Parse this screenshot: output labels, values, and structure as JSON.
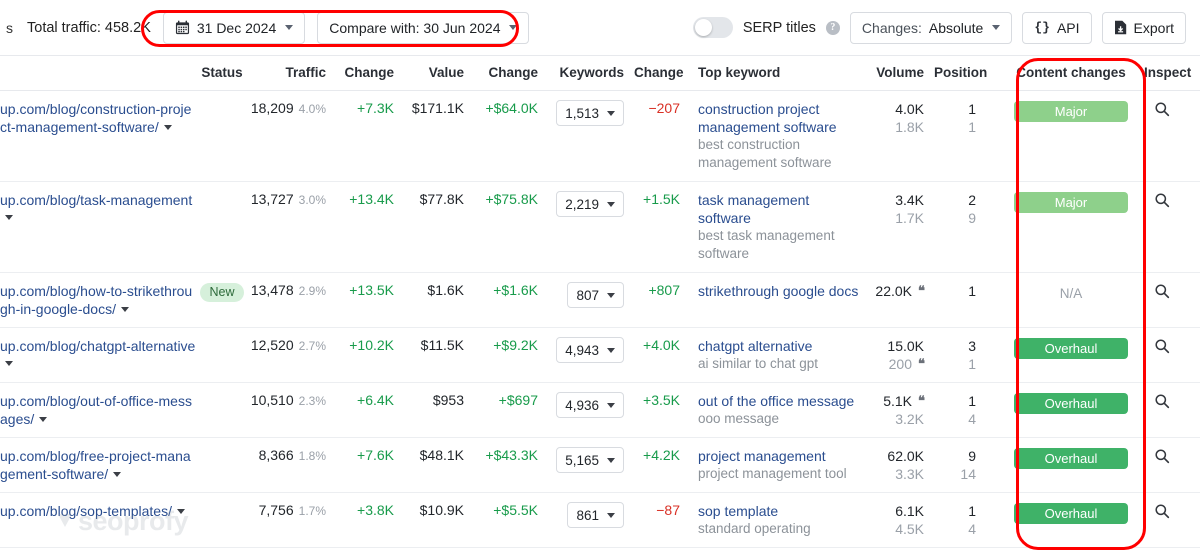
{
  "toolbar": {
    "tab_tail": "s",
    "total_traffic": "Total traffic: 458.2K",
    "date_button": "31 Dec 2024",
    "compare_button": "Compare with: 30 Jun 2024",
    "serp_titles_label": "SERP titles",
    "serp_titles_toggle": "off",
    "changes_label": "Changes:",
    "changes_value": "Absolute",
    "api_label": "API",
    "export_label": "Export",
    "calendar_icon": "calendar-icon",
    "help_icon": "help-icon",
    "api_icon": "code-braces-icon",
    "export_icon": "download-file-icon"
  },
  "watermark": "seoprofy",
  "colors": {
    "link": "#2a4d8f",
    "positive": "#189b4b",
    "negative": "#d93025",
    "chip_major": "#8ed08b",
    "chip_overhaul": "#3fb268",
    "badge_new_bg": "#d6f0db",
    "annotation": "#ff0000"
  },
  "table": {
    "columns": [
      {
        "key": "url",
        "label": ""
      },
      {
        "key": "status",
        "label": "Status"
      },
      {
        "key": "traffic",
        "label": "Traffic"
      },
      {
        "key": "traffic_change",
        "label": "Change"
      },
      {
        "key": "value",
        "label": "Value"
      },
      {
        "key": "value_change",
        "label": "Change"
      },
      {
        "key": "keywords",
        "label": "Keywords"
      },
      {
        "key": "keywords_change",
        "label": "Change"
      },
      {
        "key": "top_keyword",
        "label": "Top keyword"
      },
      {
        "key": "volume",
        "label": "Volume"
      },
      {
        "key": "position",
        "label": "Position"
      },
      {
        "key": "content_changes",
        "label": "Content changes"
      },
      {
        "key": "inspect",
        "label": "Inspect"
      }
    ],
    "rows": [
      {
        "url": "up.com/blog/construction-project-management-software/",
        "status": "",
        "traffic": "18,209",
        "traffic_pct": "4.0%",
        "traffic_change": "+7.3K",
        "traffic_change_dir": "pos",
        "value": "$171.1K",
        "value_change": "+$64.0K",
        "value_change_dir": "pos",
        "keywords": "1,513",
        "keywords_change": "−207",
        "keywords_change_dir": "neg",
        "keyword_main": "construction project management software",
        "keyword_sub": "best construction management software",
        "volume_main": "4.0K",
        "volume_sub": "1.8K",
        "volume_main_quote": false,
        "volume_sub_quote": false,
        "position_main": "1",
        "position_sub": "1",
        "content_changes": "Major",
        "content_changes_type": "major",
        "inspect_icon": "magnifier-icon"
      },
      {
        "url": "up.com/blog/task-management",
        "status": "",
        "traffic": "13,727",
        "traffic_pct": "3.0%",
        "traffic_change": "+13.4K",
        "traffic_change_dir": "pos",
        "value": "$77.8K",
        "value_change": "+$75.8K",
        "value_change_dir": "pos",
        "keywords": "2,219",
        "keywords_change": "+1.5K",
        "keywords_change_dir": "pos",
        "keyword_main": "task management software",
        "keyword_sub": "best task management software",
        "volume_main": "3.4K",
        "volume_sub": "1.7K",
        "volume_main_quote": false,
        "volume_sub_quote": false,
        "position_main": "2",
        "position_sub": "9",
        "content_changes": "Major",
        "content_changes_type": "major",
        "inspect_icon": "magnifier-icon"
      },
      {
        "url": "up.com/blog/how-to-strikethrough-in-google-docs/",
        "status": "New",
        "traffic": "13,478",
        "traffic_pct": "2.9%",
        "traffic_change": "+13.5K",
        "traffic_change_dir": "pos",
        "value": "$1.6K",
        "value_change": "+$1.6K",
        "value_change_dir": "pos",
        "keywords": "807",
        "keywords_change": "+807",
        "keywords_change_dir": "pos",
        "keyword_main": "strikethrough google docs",
        "keyword_sub": "",
        "volume_main": "22.0K",
        "volume_sub": "",
        "volume_main_quote": true,
        "volume_sub_quote": false,
        "position_main": "1",
        "position_sub": "",
        "content_changes": "N/A",
        "content_changes_type": "na",
        "inspect_icon": "magnifier-icon"
      },
      {
        "url": "up.com/blog/chatgpt-alternative",
        "status": "",
        "traffic": "12,520",
        "traffic_pct": "2.7%",
        "traffic_change": "+10.2K",
        "traffic_change_dir": "pos",
        "value": "$11.5K",
        "value_change": "+$9.2K",
        "value_change_dir": "pos",
        "keywords": "4,943",
        "keywords_change": "+4.0K",
        "keywords_change_dir": "pos",
        "keyword_main": "chatgpt alternative",
        "keyword_sub": "ai similar to chat gpt",
        "volume_main": "15.0K",
        "volume_sub": "200",
        "volume_main_quote": false,
        "volume_sub_quote": true,
        "position_main": "3",
        "position_sub": "1",
        "content_changes": "Overhaul",
        "content_changes_type": "overhaul",
        "inspect_icon": "magnifier-icon"
      },
      {
        "url": "up.com/blog/out-of-office-messages/",
        "status": "",
        "traffic": "10,510",
        "traffic_pct": "2.3%",
        "traffic_change": "+6.4K",
        "traffic_change_dir": "pos",
        "value": "$953",
        "value_change": "+$697",
        "value_change_dir": "pos",
        "keywords": "4,936",
        "keywords_change": "+3.5K",
        "keywords_change_dir": "pos",
        "keyword_main": "out of the office message",
        "keyword_sub": "ooo message",
        "volume_main": "5.1K",
        "volume_sub": "3.2K",
        "volume_main_quote": true,
        "volume_sub_quote": false,
        "position_main": "1",
        "position_sub": "4",
        "content_changes": "Overhaul",
        "content_changes_type": "overhaul",
        "inspect_icon": "magnifier-icon"
      },
      {
        "url": "up.com/blog/free-project-management-software/",
        "status": "",
        "traffic": "8,366",
        "traffic_pct": "1.8%",
        "traffic_change": "+7.6K",
        "traffic_change_dir": "pos",
        "value": "$48.1K",
        "value_change": "+$43.3K",
        "value_change_dir": "pos",
        "keywords": "5,165",
        "keywords_change": "+4.2K",
        "keywords_change_dir": "pos",
        "keyword_main": "project management",
        "keyword_sub": "project management tool",
        "volume_main": "62.0K",
        "volume_sub": "3.3K",
        "volume_main_quote": false,
        "volume_sub_quote": false,
        "position_main": "9",
        "position_sub": "14",
        "content_changes": "Overhaul",
        "content_changes_type": "overhaul",
        "inspect_icon": "magnifier-icon"
      },
      {
        "url": "up.com/blog/sop-templates/",
        "status": "",
        "traffic": "7,756",
        "traffic_pct": "1.7%",
        "traffic_change": "+3.8K",
        "traffic_change_dir": "pos",
        "value": "$10.9K",
        "value_change": "+$5.5K",
        "value_change_dir": "pos",
        "keywords": "861",
        "keywords_change": "−87",
        "keywords_change_dir": "neg",
        "keyword_main": "sop template",
        "keyword_sub": "standard operating",
        "volume_main": "6.1K",
        "volume_sub": "4.5K",
        "volume_main_quote": false,
        "volume_sub_quote": false,
        "position_main": "1",
        "position_sub": "4",
        "content_changes": "Overhaul",
        "content_changes_type": "overhaul",
        "inspect_icon": "magnifier-icon"
      }
    ]
  }
}
